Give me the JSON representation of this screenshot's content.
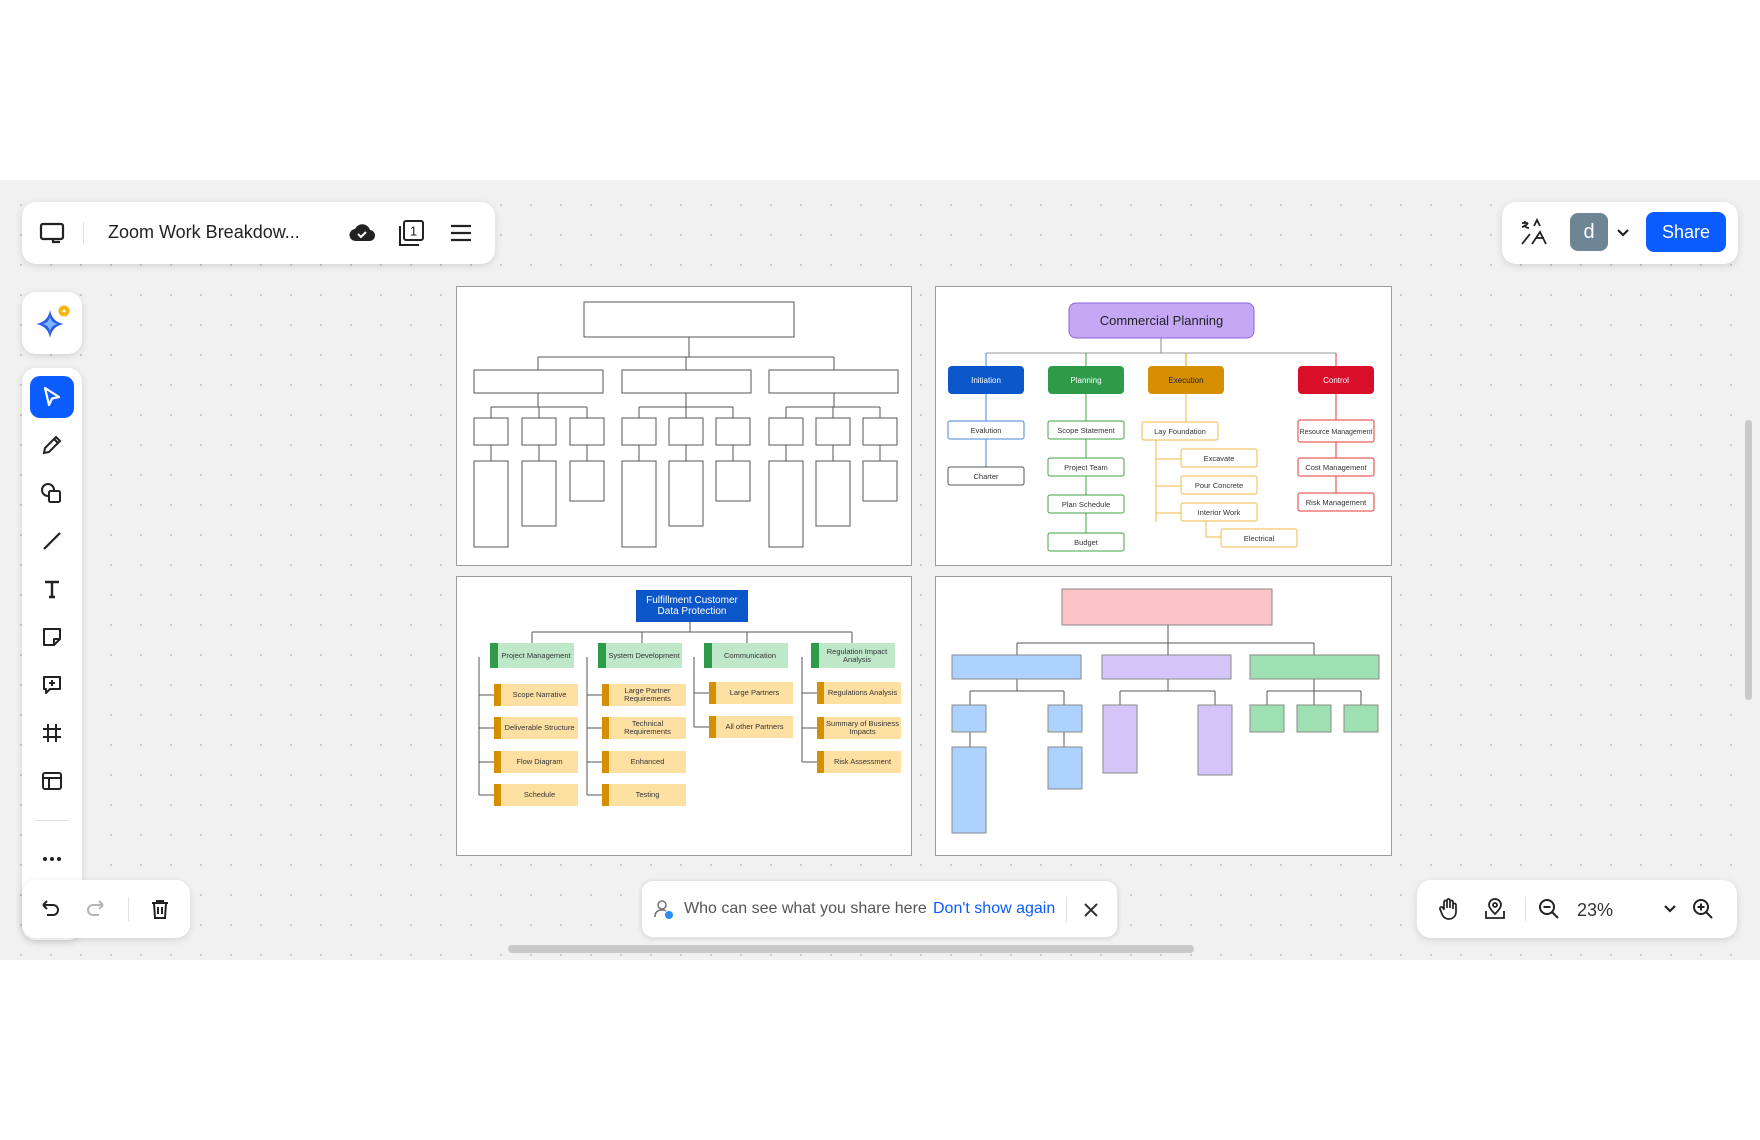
{
  "header": {
    "title": "Zoom Work Breakdow...",
    "page_count": "1",
    "avatar_letter": "d",
    "share_label": "Share"
  },
  "icons": {
    "board": "board-icon",
    "cloud_saved": "cloud-check-icon",
    "pages": "pages-icon",
    "menu": "hamburger-menu-icon",
    "ai_sparkle": "ai-sparkle-icon",
    "select": "cursor-select-icon",
    "pen": "pen-icon",
    "shapes": "shapes-icon",
    "line": "line-icon",
    "text": "text-icon",
    "sticky": "sticky-note-icon",
    "comment": "comment-icon",
    "frame": "frame-icon",
    "template": "template-icon",
    "more": "more-icon"
  },
  "colors": {
    "accent": "#0b5cff",
    "canvas": "#f1f1f1"
  },
  "notice": {
    "text": "Who can see what you share here",
    "link": "Don't show again"
  },
  "zoom": {
    "level": "23%"
  },
  "frames": {
    "commercial": {
      "root": "Commercial Planning",
      "branches": [
        "Initiation",
        "Planning",
        "Execution",
        "Control"
      ],
      "initiation_items": [
        "Evalution",
        "Charter"
      ],
      "planning_items": [
        "Scope Statement",
        "Project Team",
        "Plan Schedule",
        "Budget"
      ],
      "execution_root": "Lay Foundation",
      "execution_items": [
        "Excavate",
        "Pour Concrete",
        "Interior Work",
        "Electrical"
      ],
      "control_items": [
        "Resource Management",
        "Cost Management",
        "Risk Management"
      ]
    },
    "fulfillment": {
      "root": "Fulfillment Customer Data Protection",
      "branches": [
        "Project Management",
        "System Development",
        "Communication",
        "Regulation Impact Analysis"
      ],
      "pm_items": [
        "Scope Narrative",
        "Deliverable Structure",
        "Flow Diagram",
        "Schedule"
      ],
      "sd_items": [
        "Large Partner Requirements",
        "Technical Requirements",
        "Enhanced",
        "Testing"
      ],
      "comm_items": [
        "Large Partners",
        "All other Partners"
      ],
      "ria_items": [
        "Regulations Analysis",
        "Summary of Business Impacts",
        "Risk Assessment"
      ]
    }
  }
}
